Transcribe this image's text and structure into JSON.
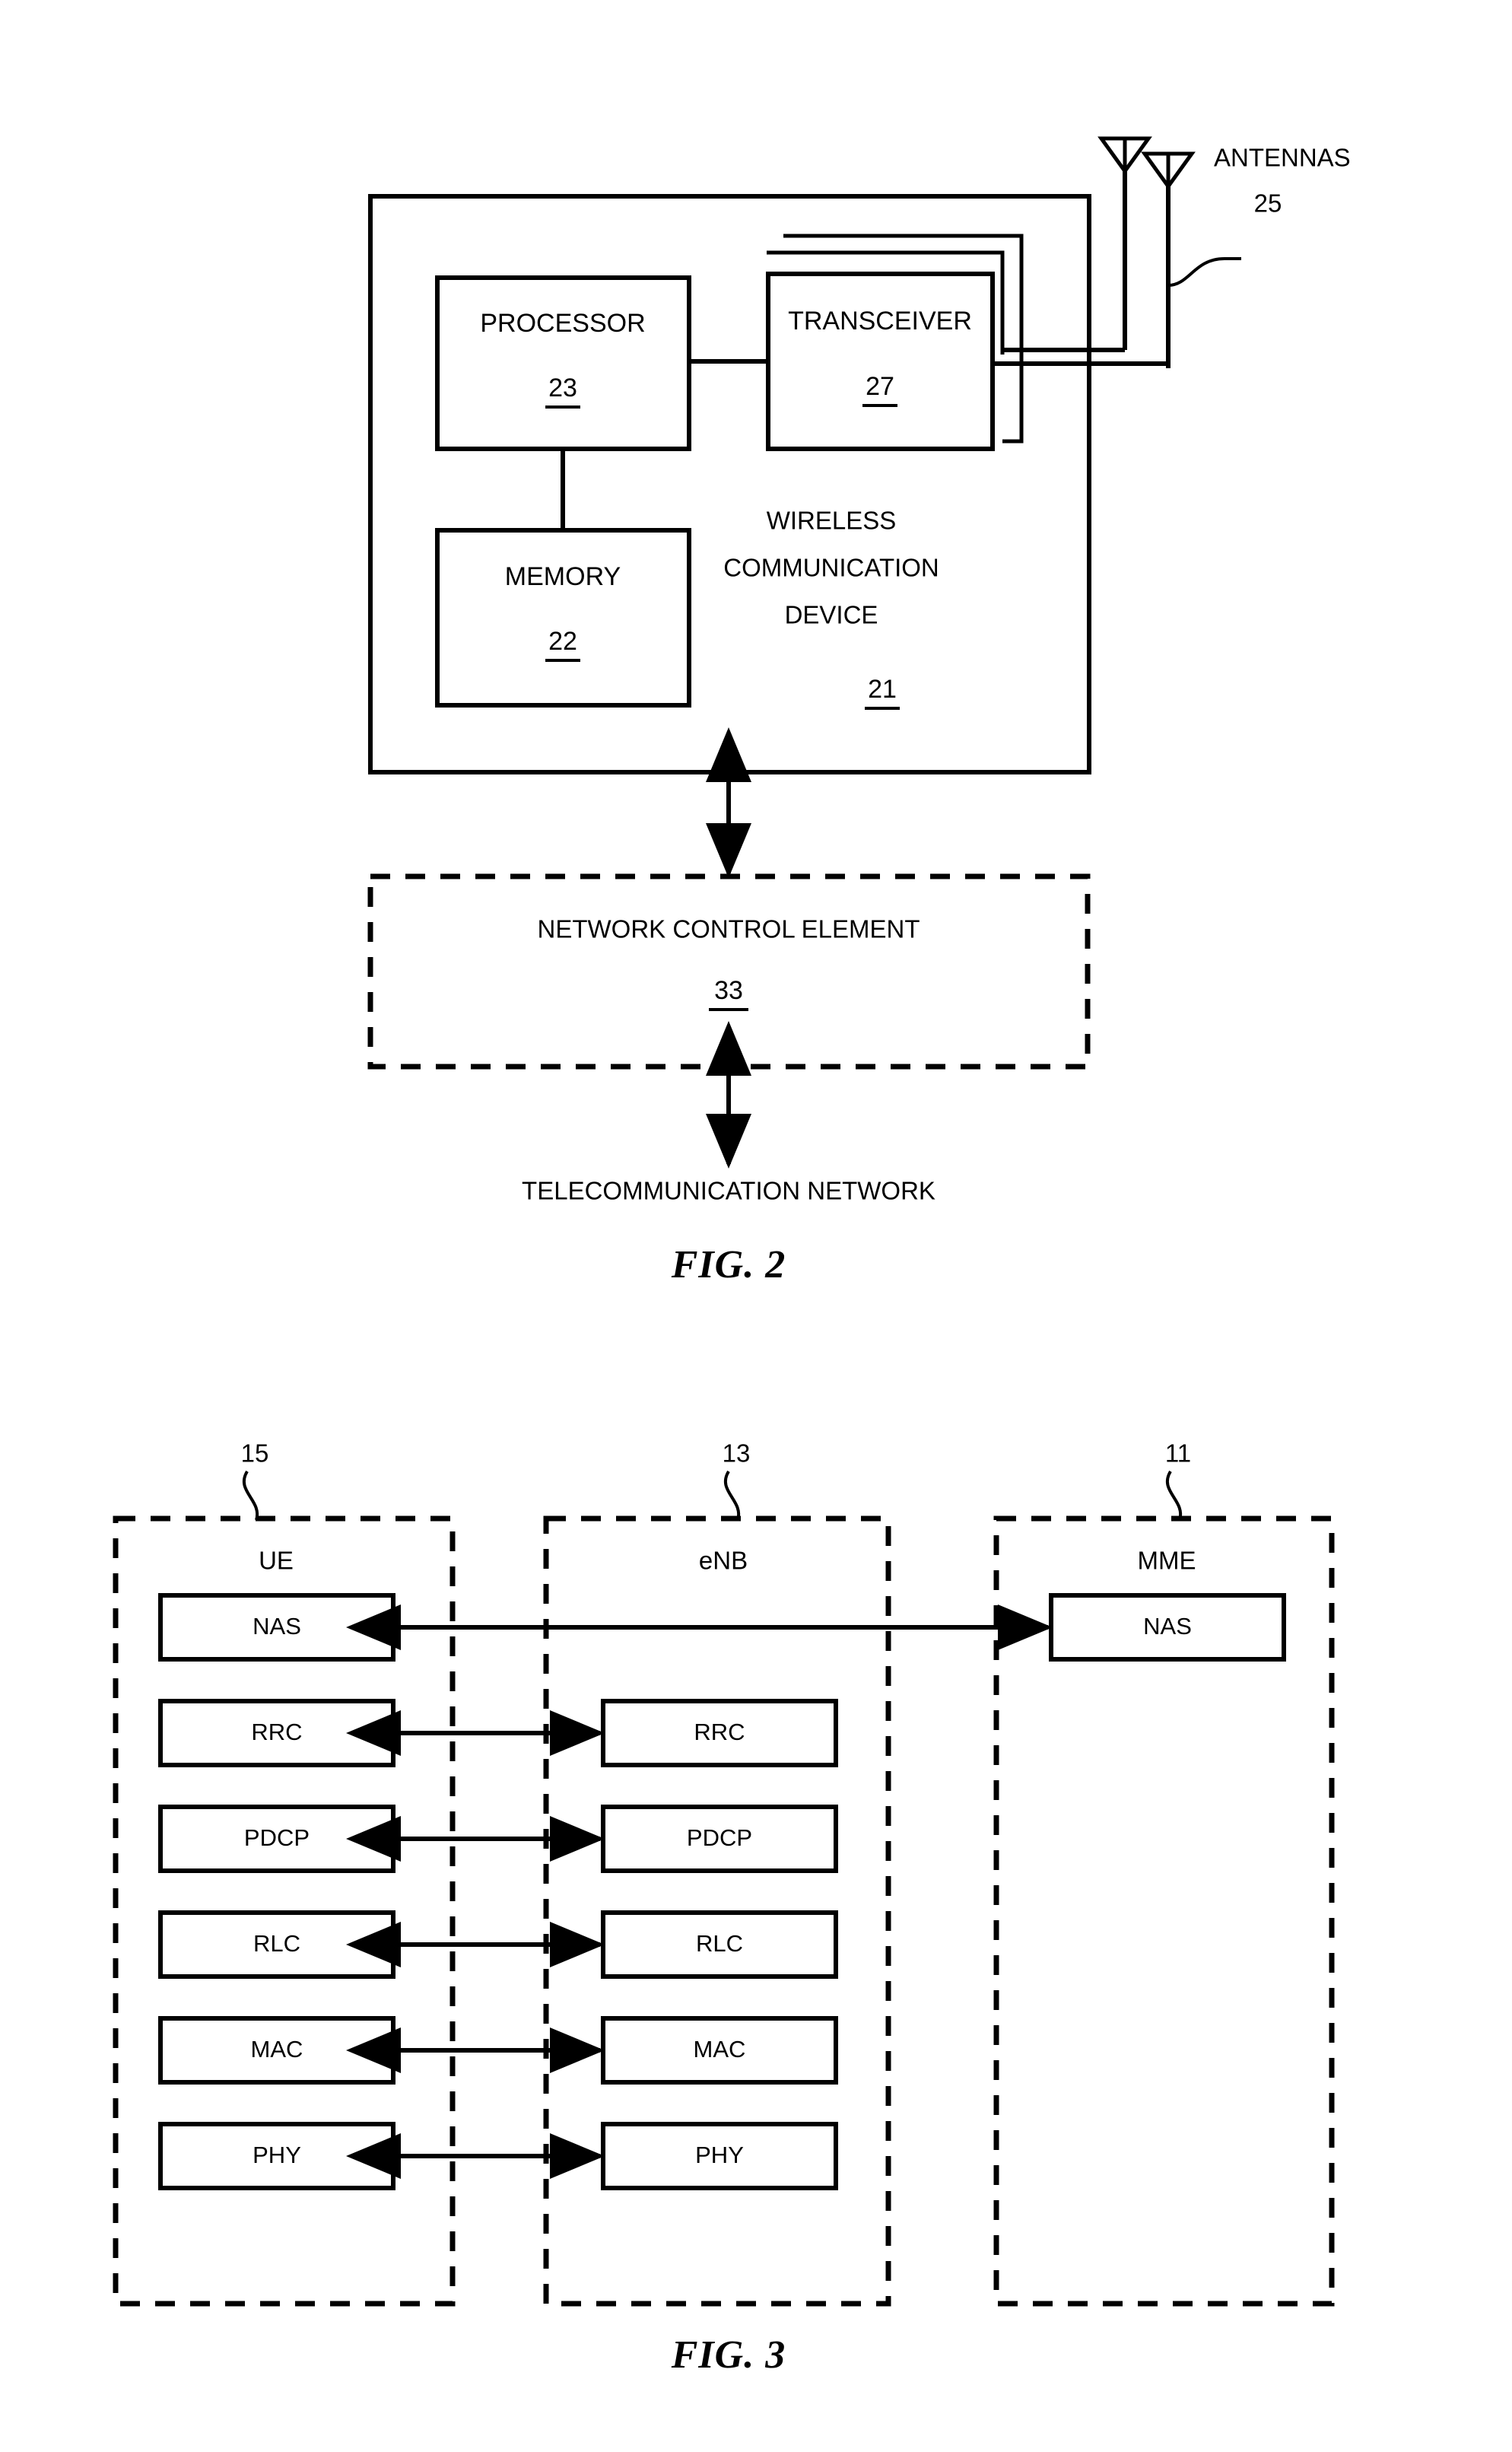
{
  "document": {
    "type": "patent-figure-sheet",
    "figures": [
      {
        "id": "fig2",
        "caption": "FIG. 2",
        "title": "Wireless communication device block diagram"
      },
      {
        "id": "fig3",
        "caption": "FIG. 3",
        "title": "LTE protocol stack diagram"
      }
    ]
  },
  "fig2": {
    "caption": "FIG. 2",
    "device": {
      "label_line1": "WIRELESS",
      "label_line2": "COMMUNICATION",
      "label_line3": "DEVICE",
      "ref": "21"
    },
    "processor": {
      "label": "PROCESSOR",
      "ref": "23"
    },
    "transceiver": {
      "label": "TRANSCEIVER",
      "ref": "27"
    },
    "memory": {
      "label": "MEMORY",
      "ref": "22"
    },
    "antennas": {
      "label": "ANTENNAS",
      "ref": "25",
      "count": 2
    },
    "network_control_element": {
      "label": "NETWORK CONTROL ELEMENT",
      "ref": "33"
    },
    "telecom_network": {
      "label": "TELECOMMUNICATION NETWORK"
    }
  },
  "fig3": {
    "caption": "FIG. 3",
    "columns": [
      {
        "name": "UE",
        "ref": "15"
      },
      {
        "name": "eNB",
        "ref": "13"
      },
      {
        "name": "MME",
        "ref": "11"
      }
    ],
    "layers": [
      {
        "name": "NAS",
        "ue": "NAS",
        "enb": null,
        "mme": "NAS",
        "link": "ue-mme",
        "bidirectional": true
      },
      {
        "name": "RRC",
        "ue": "RRC",
        "enb": "RRC",
        "mme": null,
        "link": "ue-enb",
        "bidirectional": true
      },
      {
        "name": "PDCP",
        "ue": "PDCP",
        "enb": "PDCP",
        "mme": null,
        "link": "ue-enb",
        "bidirectional": true
      },
      {
        "name": "RLC",
        "ue": "RLC",
        "enb": "RLC",
        "mme": null,
        "link": "ue-enb",
        "bidirectional": true
      },
      {
        "name": "MAC",
        "ue": "MAC",
        "enb": "MAC",
        "mme": null,
        "link": "ue-enb",
        "bidirectional": true
      },
      {
        "name": "PHY",
        "ue": "PHY",
        "enb": "PHY",
        "mme": null,
        "link": "ue-enb",
        "bidirectional": true
      }
    ]
  },
  "colors": {
    "line": "#000000",
    "background": "#ffffff",
    "text": "#000000"
  }
}
